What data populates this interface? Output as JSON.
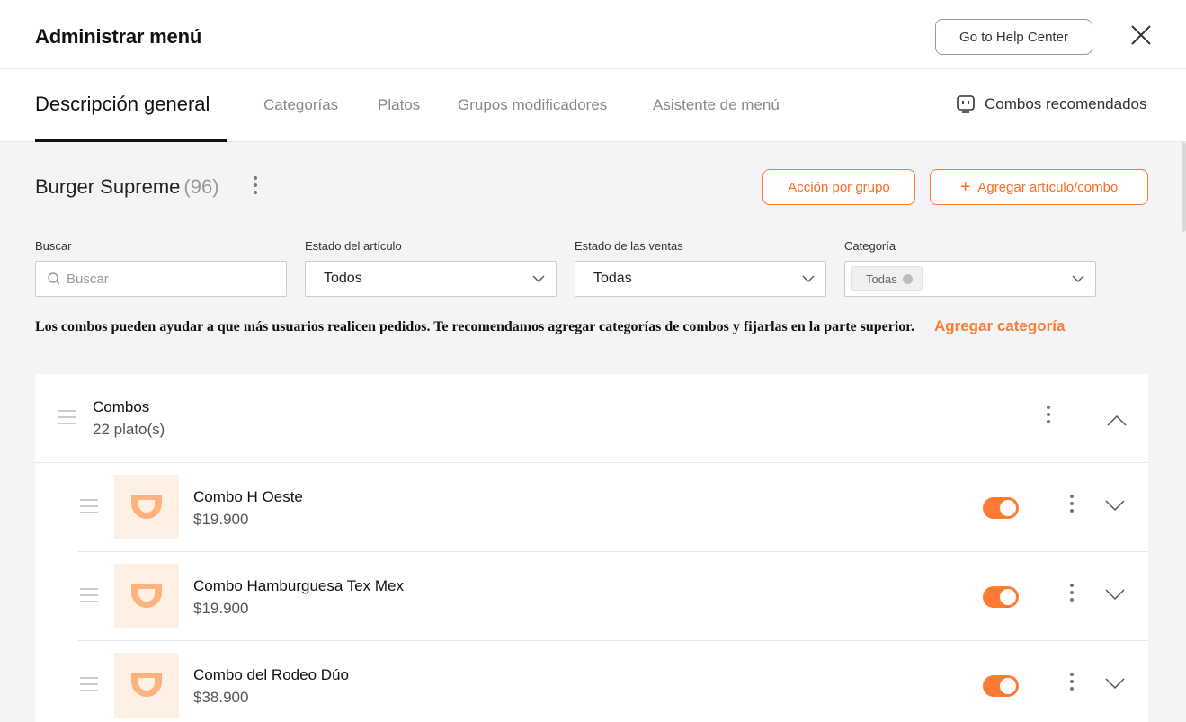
{
  "header": {
    "title": "Administrar menú",
    "help_button": "Go to Help Center",
    "close_icon": "close-icon"
  },
  "tabs": {
    "items": [
      {
        "label": "Descripción general",
        "active": true
      },
      {
        "label": "Categorías",
        "active": false
      },
      {
        "label": "Platos",
        "active": false
      },
      {
        "label": "Grupos modificadores",
        "active": false
      },
      {
        "label": "Asistente de menú",
        "active": false
      }
    ],
    "recommended": {
      "label": "Combos recomendados",
      "icon": "robot-icon"
    }
  },
  "store": {
    "name": "Burger Supreme",
    "count": "(96)",
    "group_action_button": "Acción por grupo",
    "add_item_button": "Agregar artículo/combo"
  },
  "filters": {
    "search": {
      "label": "Buscar",
      "placeholder": "Buscar"
    },
    "item_status": {
      "label": "Estado del artículo",
      "value": "Todos"
    },
    "sales_status": {
      "label": "Estado de las ventas",
      "value": "Todas"
    },
    "category": {
      "label": "Categoría",
      "value": "Todas"
    }
  },
  "notice": {
    "text": "Los combos pueden ayudar a que más usuarios realicen pedidos. Te recomendamos agregar categorías de combos y fijarlas en la parte superior.",
    "link": "Agregar categoría"
  },
  "category": {
    "name": "Combos",
    "count": "22 plato(s)",
    "expanded": true
  },
  "items": [
    {
      "name": "Combo H Oeste",
      "price": "$19.900",
      "enabled": true
    },
    {
      "name": "Combo Hamburguesa Tex Mex",
      "price": "$19.900",
      "enabled": true
    },
    {
      "name": "Combo del Rodeo Dúo",
      "price": "$38.900",
      "enabled": true
    }
  ],
  "colors": {
    "accent": "#ff7a33",
    "thumb_bg": "#fff0e6",
    "page_bg": "#f4f4f6"
  }
}
